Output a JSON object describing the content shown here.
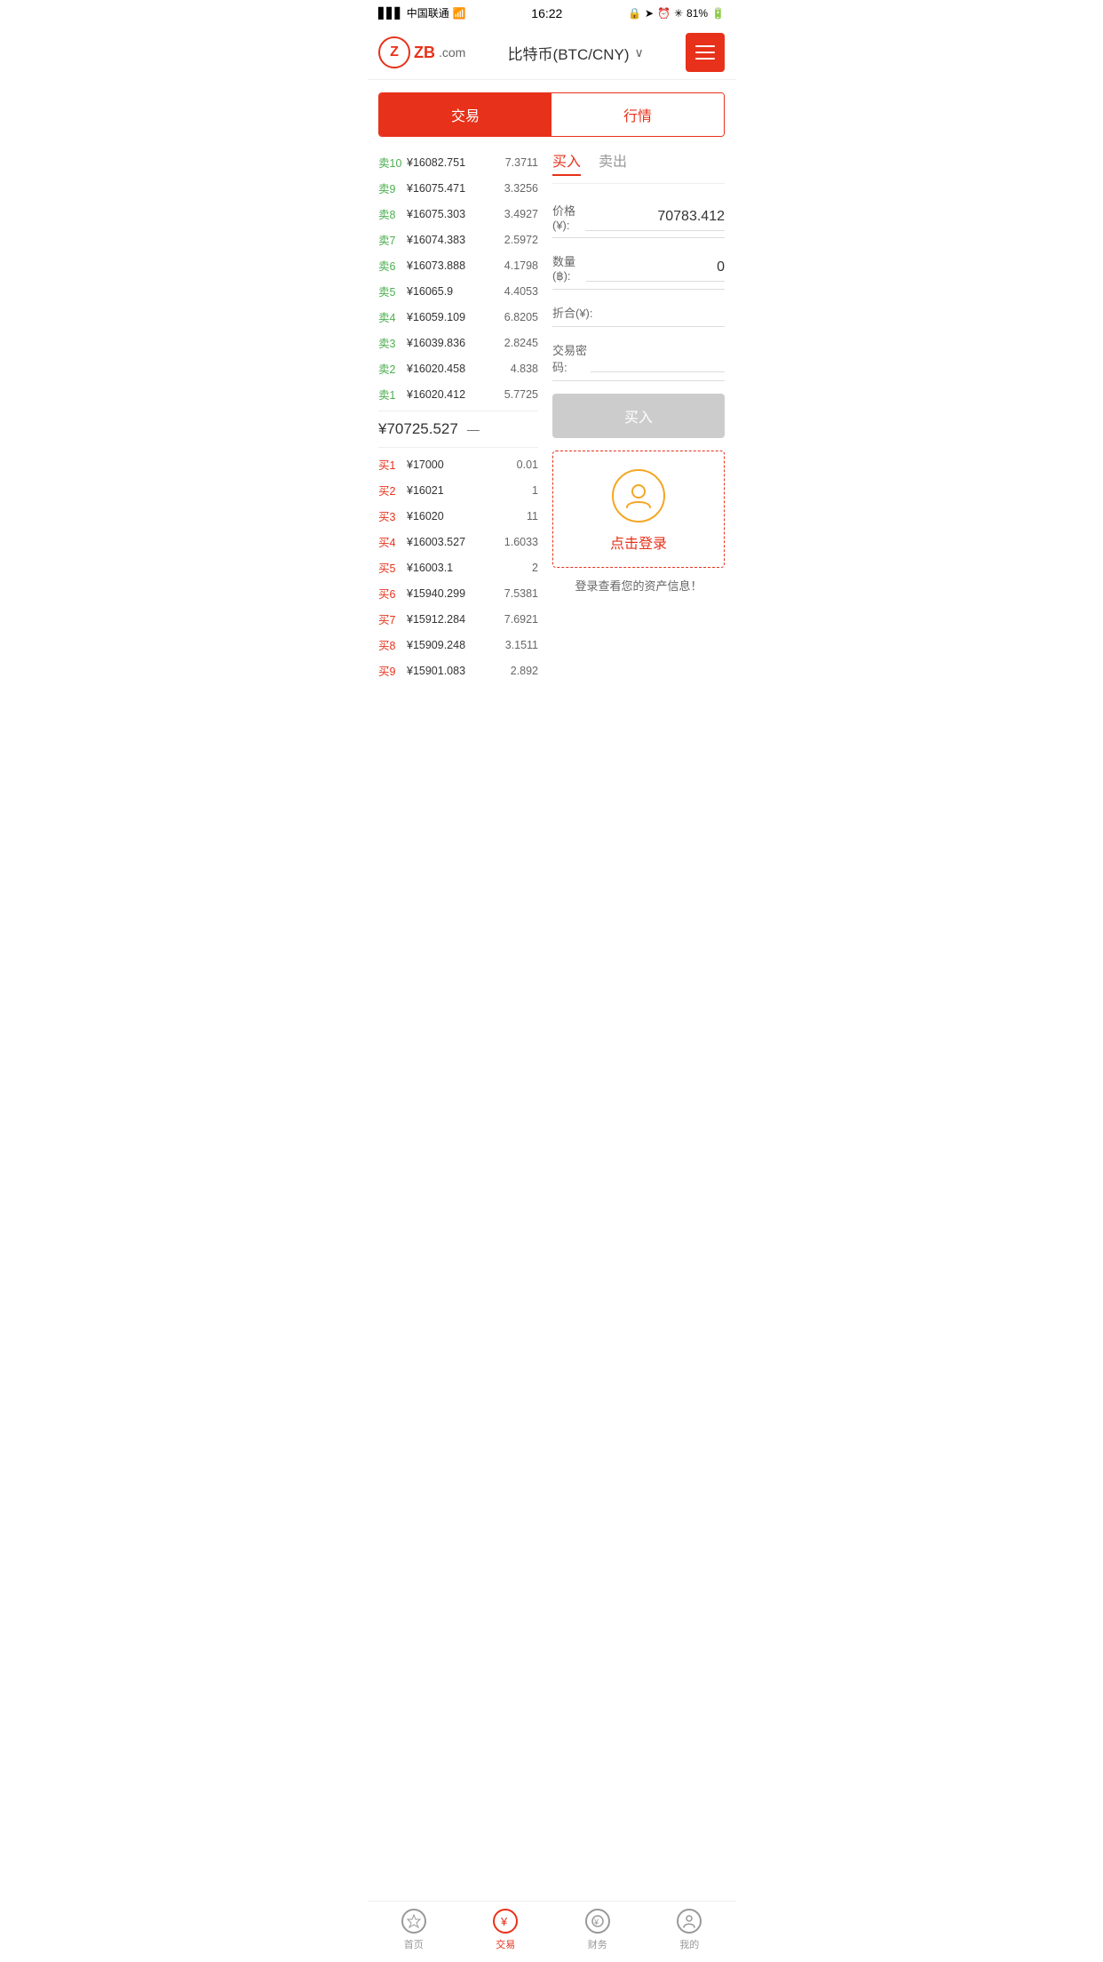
{
  "statusBar": {
    "carrier": "中国联通",
    "time": "16:22",
    "battery": "81%"
  },
  "header": {
    "title": "比特币(BTC/CNY)",
    "menuIcon": "≡"
  },
  "tabs": [
    {
      "id": "trade",
      "label": "交易",
      "active": true
    },
    {
      "id": "market",
      "label": "行情",
      "active": false
    }
  ],
  "buySellTabs": [
    {
      "id": "buy",
      "label": "买入",
      "active": true
    },
    {
      "id": "sell",
      "label": "卖出",
      "active": false
    }
  ],
  "sellOrders": [
    {
      "label": "卖10",
      "price": "¥16082.751",
      "amount": "7.3711"
    },
    {
      "label": "卖9",
      "price": "¥16075.471",
      "amount": "3.3256"
    },
    {
      "label": "卖8",
      "price": "¥16075.303",
      "amount": "3.4927"
    },
    {
      "label": "卖7",
      "price": "¥16074.383",
      "amount": "2.5972"
    },
    {
      "label": "卖6",
      "price": "¥16073.888",
      "amount": "4.1798"
    },
    {
      "label": "卖5",
      "price": "¥16065.9",
      "amount": "4.4053"
    },
    {
      "label": "卖4",
      "price": "¥16059.109",
      "amount": "6.8205"
    },
    {
      "label": "卖3",
      "price": "¥16039.836",
      "amount": "2.8245"
    },
    {
      "label": "卖2",
      "price": "¥16020.458",
      "amount": "4.838"
    },
    {
      "label": "卖1",
      "price": "¥16020.412",
      "amount": "5.7725"
    }
  ],
  "midPrice": {
    "value": "¥70725.527",
    "icon": "—"
  },
  "buyOrders": [
    {
      "label": "买1",
      "price": "¥17000",
      "amount": "0.01"
    },
    {
      "label": "买2",
      "price": "¥16021",
      "amount": "1"
    },
    {
      "label": "买3",
      "price": "¥16020",
      "amount": "11"
    },
    {
      "label": "买4",
      "price": "¥16003.527",
      "amount": "1.6033"
    },
    {
      "label": "买5",
      "price": "¥16003.1",
      "amount": "2"
    },
    {
      "label": "买6",
      "price": "¥15940.299",
      "amount": "7.5381"
    },
    {
      "label": "买7",
      "price": "¥15912.284",
      "amount": "7.6921"
    },
    {
      "label": "买8",
      "price": "¥15909.248",
      "amount": "3.1511"
    },
    {
      "label": "买9",
      "price": "¥15901.083",
      "amount": "2.892"
    }
  ],
  "tradeForm": {
    "priceLabel": "价格(¥):",
    "priceValue": "70783.412",
    "quantityLabel": "数量(฿):",
    "quantityValue": "0",
    "totalLabel": "折合(¥):",
    "totalValue": "",
    "passwordLabel": "交易密码:",
    "buyButtonLabel": "买入"
  },
  "loginPrompt": {
    "clickToLogin": "点击登录",
    "message": "登录查看您的资产信息！"
  },
  "bottomNav": [
    {
      "id": "home",
      "label": "首页",
      "active": false,
      "icon": "★"
    },
    {
      "id": "trade",
      "label": "交易",
      "active": true,
      "icon": "¥"
    },
    {
      "id": "finance",
      "label": "财务",
      "active": false,
      "icon": "💰"
    },
    {
      "id": "mine",
      "label": "我的",
      "active": false,
      "icon": "👤"
    }
  ]
}
